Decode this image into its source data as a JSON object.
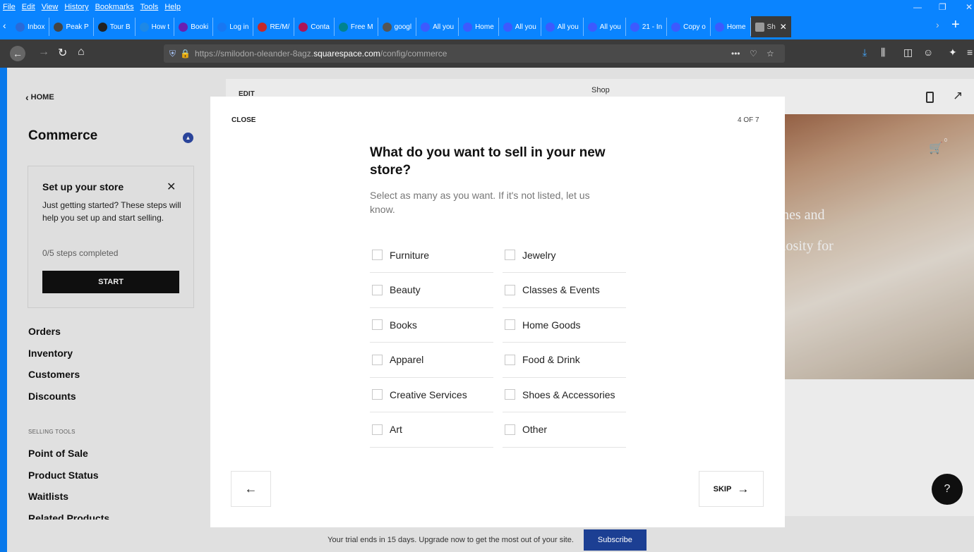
{
  "browser": {
    "menu": [
      "File",
      "Edit",
      "View",
      "History",
      "Bookmarks",
      "Tools",
      "Help"
    ],
    "tabs": [
      {
        "label": "Inbox",
        "fav": "#2a6ad8"
      },
      {
        "label": "Peak P",
        "fav": "#444"
      },
      {
        "label": "Tour B",
        "fav": "#222"
      },
      {
        "label": "How t",
        "fav": "#1e88e5"
      },
      {
        "label": "Booki",
        "fav": "#6a1fb1"
      },
      {
        "label": "Log in",
        "fav": "#1877f2"
      },
      {
        "label": "RE/M/",
        "fav": "#c62828"
      },
      {
        "label": "Conta",
        "fav": "#ad1457"
      },
      {
        "label": "Free M",
        "fav": "#00838f"
      },
      {
        "label": "googl",
        "fav": "#555"
      },
      {
        "label": "All you",
        "fav": "#3d5afe"
      },
      {
        "label": "Home",
        "fav": "#3d5afe"
      },
      {
        "label": "All you",
        "fav": "#3d5afe"
      },
      {
        "label": "All you",
        "fav": "#3d5afe"
      },
      {
        "label": "All you",
        "fav": "#3d5afe"
      },
      {
        "label": "21 - In",
        "fav": "#3d5afe"
      },
      {
        "label": "Copy o",
        "fav": "#3d5afe"
      },
      {
        "label": "Home",
        "fav": "#3d5afe"
      }
    ],
    "active_tab": {
      "label": "Sh",
      "close": "✕"
    },
    "url_prefix": "https://smilodon-oleander-8agz.",
    "url_domain": "squarespace.com",
    "url_path": "/config/commerce",
    "url_dots": "•••"
  },
  "sidebar": {
    "back": "HOME",
    "title": "Commerce",
    "setup": {
      "title": "Set up your store",
      "desc": "Just getting started? These steps will help you set up and start selling.",
      "progress": "0/5 steps completed",
      "start": "START"
    },
    "nav": [
      "Orders",
      "Inventory",
      "Customers",
      "Discounts"
    ],
    "section_label": "SELLING TOOLS",
    "tools": [
      "Point of Sale",
      "Product Status",
      "Waitlists",
      "Related Products"
    ]
  },
  "preview": {
    "edit": "EDIT",
    "page_title": "Shop",
    "hero_text_1": "hes and",
    "hero_text_2": "iosity for",
    "cart_count": "0",
    "help": "?"
  },
  "modal": {
    "close": "CLOSE",
    "step": "4 OF 7",
    "heading": "What do you want to sell in your new store?",
    "subheading": "Select as many as you want. If it's not listed, let us know.",
    "options_left": [
      "Furniture",
      "Beauty",
      "Books",
      "Apparel",
      "Creative Services",
      "Art"
    ],
    "options_right": [
      "Jewelry",
      "Classes & Events",
      "Home Goods",
      "Food & Drink",
      "Shoes & Accessories",
      "Other"
    ],
    "back_arrow": "←",
    "skip": "SKIP",
    "skip_arrow": "→"
  },
  "trial": {
    "text": "Your trial ends in 15 days. Upgrade now to get the most out of your site.",
    "subscribe": "Subscribe"
  }
}
